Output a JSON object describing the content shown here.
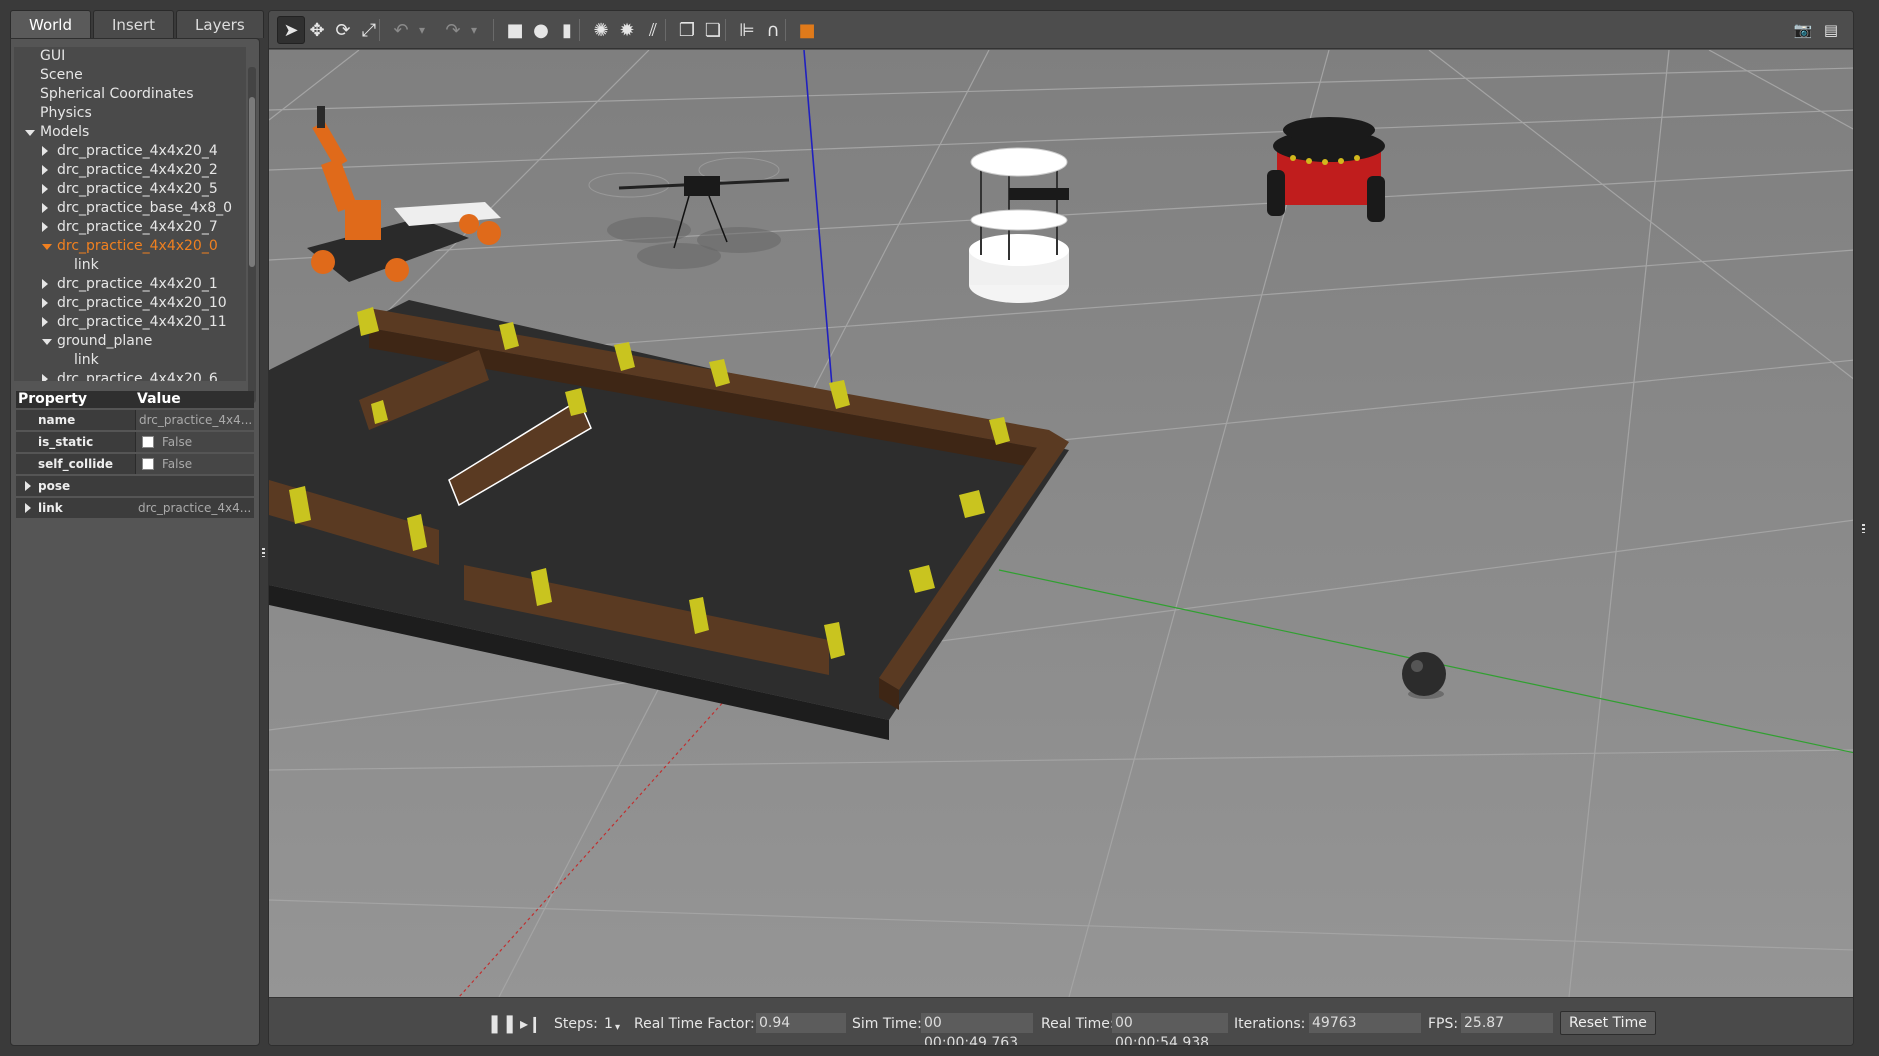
{
  "tabs": [
    {
      "label": "World",
      "active": true
    },
    {
      "label": "Insert",
      "active": false
    },
    {
      "label": "Layers",
      "active": false
    }
  ],
  "tree": [
    {
      "label": "GUI",
      "indent": 0,
      "caret": "none"
    },
    {
      "label": "Scene",
      "indent": 0,
      "caret": "none"
    },
    {
      "label": "Spherical Coordinates",
      "indent": 0,
      "caret": "none"
    },
    {
      "label": "Physics",
      "indent": 0,
      "caret": "none"
    },
    {
      "label": "Models",
      "indent": 0,
      "caret": "down"
    },
    {
      "label": "drc_practice_4x4x20_4",
      "indent": 1,
      "caret": "right"
    },
    {
      "label": "drc_practice_4x4x20_2",
      "indent": 1,
      "caret": "right"
    },
    {
      "label": "drc_practice_4x4x20_5",
      "indent": 1,
      "caret": "right"
    },
    {
      "label": "drc_practice_base_4x8_0",
      "indent": 1,
      "caret": "right"
    },
    {
      "label": "drc_practice_4x4x20_7",
      "indent": 1,
      "caret": "right"
    },
    {
      "label": "drc_practice_4x4x20_0",
      "indent": 1,
      "caret": "down",
      "selected": true
    },
    {
      "label": "link",
      "indent": 2,
      "caret": "none"
    },
    {
      "label": "drc_practice_4x4x20_1",
      "indent": 1,
      "caret": "right"
    },
    {
      "label": "drc_practice_4x4x20_10",
      "indent": 1,
      "caret": "right"
    },
    {
      "label": "drc_practice_4x4x20_11",
      "indent": 1,
      "caret": "right"
    },
    {
      "label": "ground_plane",
      "indent": 1,
      "caret": "down"
    },
    {
      "label": "link",
      "indent": 2,
      "caret": "none"
    },
    {
      "label": "drc_practice_4x4x20_6",
      "indent": 1,
      "caret": "right"
    }
  ],
  "properties": {
    "header": {
      "property": "Property",
      "value": "Value"
    },
    "rows": [
      {
        "key": "name",
        "value": "drc_practice_4x4...",
        "type": "text"
      },
      {
        "key": "is_static",
        "value": "False",
        "type": "checkbox"
      },
      {
        "key": "self_collide",
        "value": "False",
        "type": "checkbox"
      },
      {
        "key": "pose",
        "value": "",
        "type": "group"
      },
      {
        "key": "link",
        "value": "drc_practice_4x4...",
        "type": "group"
      }
    ]
  },
  "toolbar": {
    "icons": [
      {
        "name": "select-arrow-icon",
        "glyph": "➤",
        "active": true
      },
      {
        "name": "translate-icon",
        "glyph": "✥"
      },
      {
        "name": "rotate-icon",
        "glyph": "⟳"
      },
      {
        "name": "scale-icon",
        "glyph": "⤢"
      },
      {
        "name": "undo-icon",
        "glyph": "↶",
        "dim": true
      },
      {
        "name": "undo-history-icon",
        "glyph": "▾",
        "dim": true
      },
      {
        "name": "redo-icon",
        "glyph": "↷",
        "dim": true
      },
      {
        "name": "redo-history-icon",
        "glyph": "▾",
        "dim": true
      },
      {
        "name": "box-shape-icon",
        "glyph": "■"
      },
      {
        "name": "sphere-shape-icon",
        "glyph": "●"
      },
      {
        "name": "cylinder-shape-icon",
        "glyph": "▮"
      },
      {
        "name": "point-light-icon",
        "glyph": "✺"
      },
      {
        "name": "spot-light-icon",
        "glyph": "✹"
      },
      {
        "name": "directional-light-icon",
        "glyph": "⫽"
      },
      {
        "name": "copy-icon",
        "glyph": "❐"
      },
      {
        "name": "paste-icon",
        "glyph": "❏"
      },
      {
        "name": "align-icon",
        "glyph": "⊫"
      },
      {
        "name": "snap-icon",
        "glyph": "∩"
      },
      {
        "name": "change-view-icon",
        "glyph": "■"
      },
      {
        "name": "screenshot-icon",
        "glyph": "📷"
      },
      {
        "name": "log-icon",
        "glyph": "▤"
      }
    ]
  },
  "status": {
    "steps_label": "Steps:",
    "steps_value": "1",
    "rtf_label": "Real Time Factor:",
    "rtf_value": "0.94",
    "sim_label": "Sim Time:",
    "sim_value": "00 00:00:49.763",
    "real_label": "Real Time:",
    "real_value": "00 00:00:54.938",
    "iter_label": "Iterations:",
    "iter_value": "49763",
    "fps_label": "FPS:",
    "fps_value": "25.87",
    "reset_label": "Reset Time"
  },
  "colors": {
    "selected": "#f08020",
    "ground": "#8e8e8e",
    "platform": "#2e2e2e",
    "wood": "#5a3a22",
    "stripe": "#c9c41f",
    "axis_x": "#c03030",
    "axis_y": "#30a030",
    "axis_z": "#2020c0"
  }
}
